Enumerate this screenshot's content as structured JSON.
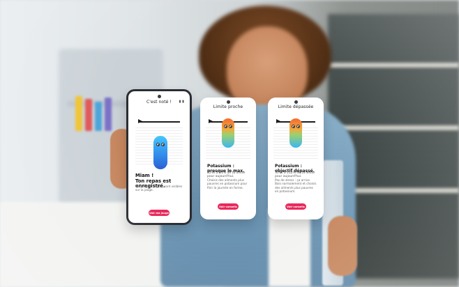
{
  "screens": [
    {
      "name": "confirmation",
      "header": "C'est noté !",
      "status_icons": "▮ ▮",
      "title_line1": "Miam !",
      "title_line2": "Ton repas est enregistré.",
      "body": "Tes progrès du jour sont visibles sur la jauge.",
      "button": "Voir ma jauge",
      "character_state": "calm"
    },
    {
      "name": "near_limit",
      "header": "Limite proche",
      "title": "Potassium : presque le max.",
      "subtitle": "Tu es à 91% de ta limite pour aujourd'hui.",
      "body": "Choisis des aliments plus pauvres en potassium pour finir la journée en forme.",
      "button": "Voir conseils",
      "character_state": "warn"
    },
    {
      "name": "limit_exceeded",
      "header": "Limite dépassée",
      "title": "Potassium : objectif dépassé.",
      "subtitle": "Tu es à 112% de ta limite pour aujourd'hui.",
      "body": "Pas de stress : ça arrive. Bois normalement et choisis des aliments plus pauvres en potassium.",
      "button": "Voir conseils",
      "character_state": "alert"
    }
  ]
}
